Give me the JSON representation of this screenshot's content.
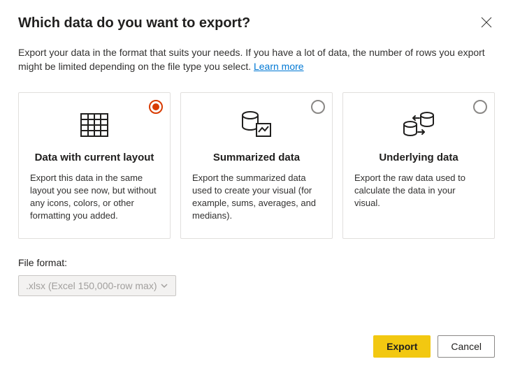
{
  "dialog": {
    "title": "Which data do you want to export?",
    "description": "Export your data in the format that suits your needs. If you have a lot of data, the number of rows you export might be limited depending on the file type you select.  ",
    "learn_more": "Learn more"
  },
  "options": [
    {
      "title": "Data with current layout",
      "description": "Export this data in the same layout you see now, but without any icons, colors, or other formatting you added.",
      "selected": true,
      "icon": "table-icon"
    },
    {
      "title": "Summarized data",
      "description": "Export the summarized data used to create your visual (for example, sums, averages, and medians).",
      "selected": false,
      "icon": "summarized-icon"
    },
    {
      "title": "Underlying data",
      "description": "Export the raw data used to calculate the data in your visual.",
      "selected": false,
      "icon": "underlying-icon"
    }
  ],
  "file_format": {
    "label": "File format:",
    "selected": ".xlsx (Excel 150,000-row max)"
  },
  "buttons": {
    "export": "Export",
    "cancel": "Cancel"
  }
}
